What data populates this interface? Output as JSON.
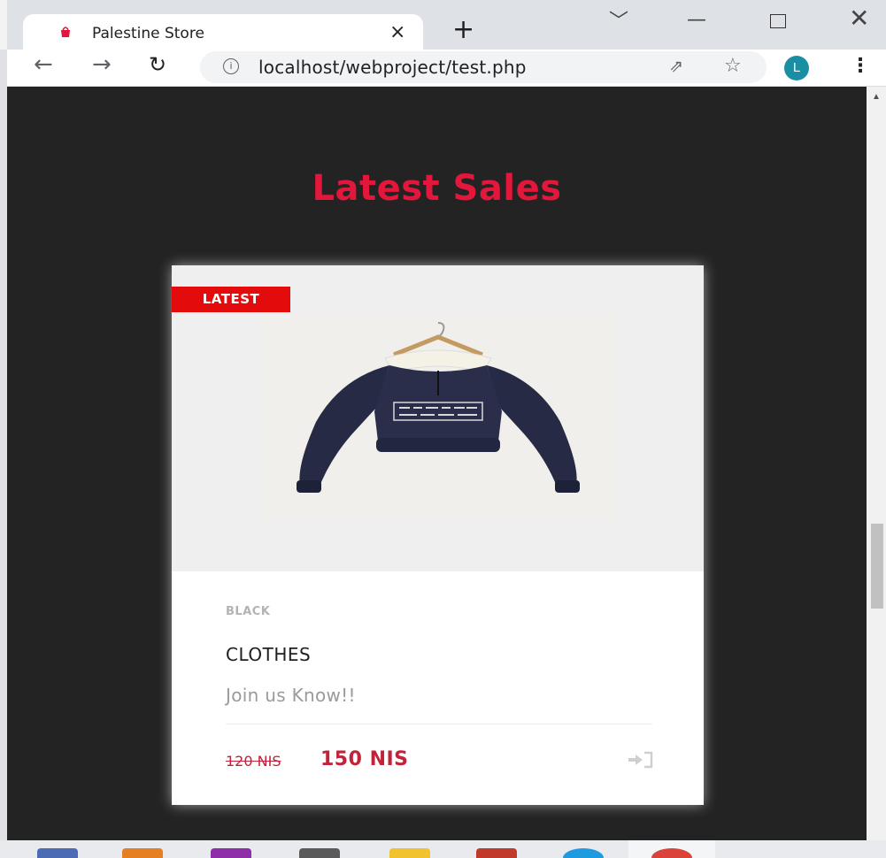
{
  "browser": {
    "tab_title": "Palestine Store",
    "tab_close_glyph": "×",
    "new_tab_glyph": "+",
    "url": "localhost/webproject/test.php",
    "avatar_letter": "L",
    "icons": [
      "back-arrow-icon",
      "forward-arrow-icon",
      "reload-icon",
      "info-icon",
      "share-icon",
      "star-icon",
      "menu-icon"
    ]
  },
  "section": {
    "title": "Latest Sales"
  },
  "product": {
    "badge": "LATEST",
    "category": "BLACK",
    "name": "CLOTHES",
    "tagline": "Join us Know!!",
    "old_price": "120 NIS",
    "new_price": "150 NIS"
  },
  "colors": {
    "accent_red": "#e3163c",
    "badge_red": "#e30b0b",
    "price_red": "#c2223a",
    "page_background": "#232323",
    "avatar_teal": "#1a8fa3"
  }
}
